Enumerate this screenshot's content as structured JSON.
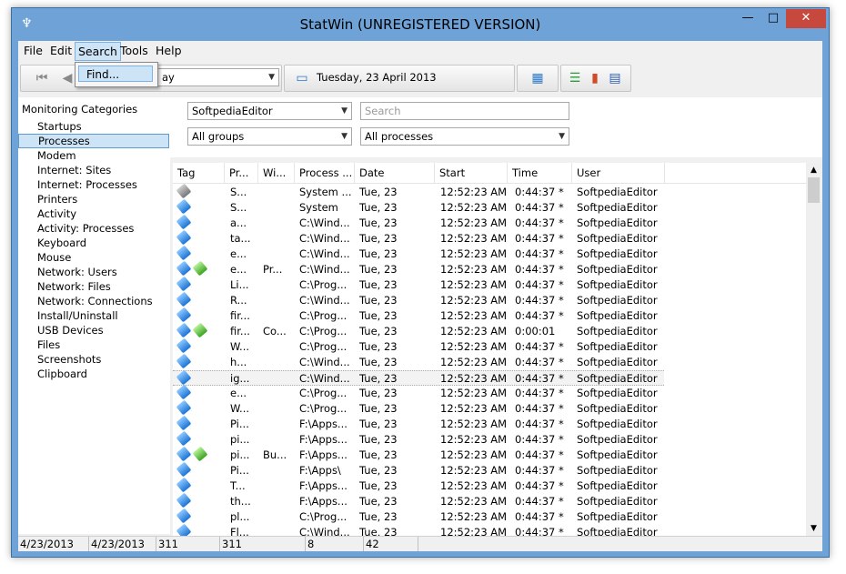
{
  "window": {
    "title": "StatWin (UNREGISTERED VERSION)",
    "minimize": "—",
    "maximize": "□",
    "close": "✕"
  },
  "menu": {
    "file": "File",
    "edit": "Edit",
    "search": "Search",
    "tools": "Tools",
    "help": "Help",
    "find_item": "Find..."
  },
  "toolbar": {
    "period_value": "ay",
    "date_text": "Tuesday, 23 April 2013"
  },
  "sidebar": {
    "header": "Monitoring Categories",
    "items": [
      "Startups",
      "Processes",
      "Modem",
      "Internet: Sites",
      "Internet: Processes",
      "Printers",
      "Activity",
      "Activity: Processes",
      "Keyboard",
      "Mouse",
      "Network: Users",
      "Network: Files",
      "Network: Connections",
      "Install/Uninstall",
      "USB Devices",
      "Files",
      "Screenshots",
      "Clipboard"
    ],
    "selected": "Processes"
  },
  "filters": {
    "user": "SoftpediaEditor",
    "search_placeholder": "Search",
    "groups": "All groups",
    "processes": "All processes"
  },
  "table": {
    "columns": [
      "Tag",
      "Pr...",
      "Wi...",
      "Process ...",
      "Date",
      "Start",
      "Time",
      "User"
    ],
    "rows": [
      {
        "tags": [
          "gray"
        ],
        "pr": "S...",
        "wi": "",
        "proc": "System ...",
        "date": "Tue, 23",
        "start": "12:52:23 AM",
        "time": "0:44:37 *",
        "user": "SoftpediaEditor"
      },
      {
        "tags": [
          "blue"
        ],
        "pr": "S...",
        "wi": "",
        "proc": "System",
        "date": "Tue, 23",
        "start": "12:52:23 AM",
        "time": "0:44:37 *",
        "user": "SoftpediaEditor"
      },
      {
        "tags": [
          "blue"
        ],
        "pr": "a...",
        "wi": "",
        "proc": "C:\\Wind...",
        "date": "Tue, 23",
        "start": "12:52:23 AM",
        "time": "0:44:37 *",
        "user": "SoftpediaEditor"
      },
      {
        "tags": [
          "blue"
        ],
        "pr": "ta...",
        "wi": "",
        "proc": "C:\\Wind...",
        "date": "Tue, 23",
        "start": "12:52:23 AM",
        "time": "0:44:37 *",
        "user": "SoftpediaEditor"
      },
      {
        "tags": [
          "blue"
        ],
        "pr": "e...",
        "wi": "",
        "proc": "C:\\Wind...",
        "date": "Tue, 23",
        "start": "12:52:23 AM",
        "time": "0:44:37 *",
        "user": "SoftpediaEditor"
      },
      {
        "tags": [
          "blue",
          "green"
        ],
        "pr": "e...",
        "wi": "Pr...",
        "proc": "C:\\Wind...",
        "date": "Tue, 23",
        "start": "12:52:23 AM",
        "time": "0:44:37 *",
        "user": "SoftpediaEditor"
      },
      {
        "tags": [
          "blue"
        ],
        "pr": "Li...",
        "wi": "",
        "proc": "C:\\Prog...",
        "date": "Tue, 23",
        "start": "12:52:23 AM",
        "time": "0:44:37 *",
        "user": "SoftpediaEditor"
      },
      {
        "tags": [
          "blue"
        ],
        "pr": "R...",
        "wi": "",
        "proc": "C:\\Wind...",
        "date": "Tue, 23",
        "start": "12:52:23 AM",
        "time": "0:44:37 *",
        "user": "SoftpediaEditor"
      },
      {
        "tags": [
          "blue"
        ],
        "pr": "fir...",
        "wi": "",
        "proc": "C:\\Prog...",
        "date": "Tue, 23",
        "start": "12:52:23 AM",
        "time": "0:44:37 *",
        "user": "SoftpediaEditor"
      },
      {
        "tags": [
          "blue",
          "green"
        ],
        "pr": "fir...",
        "wi": "Co...",
        "proc": "C:\\Prog...",
        "date": "Tue, 23",
        "start": "12:52:23 AM",
        "time": "0:00:01",
        "user": "SoftpediaEditor"
      },
      {
        "tags": [
          "blue"
        ],
        "pr": "W...",
        "wi": "",
        "proc": "C:\\Prog...",
        "date": "Tue, 23",
        "start": "12:52:23 AM",
        "time": "0:44:37 *",
        "user": "SoftpediaEditor"
      },
      {
        "tags": [
          "blue"
        ],
        "pr": "h...",
        "wi": "",
        "proc": "C:\\Wind...",
        "date": "Tue, 23",
        "start": "12:52:23 AM",
        "time": "0:44:37 *",
        "user": "SoftpediaEditor"
      },
      {
        "tags": [
          "blue"
        ],
        "pr": "ig...",
        "wi": "",
        "proc": "C:\\Wind...",
        "date": "Tue, 23",
        "start": "12:52:23 AM",
        "time": "0:44:37 *",
        "user": "SoftpediaEditor",
        "highlight": true
      },
      {
        "tags": [
          "blue"
        ],
        "pr": "e...",
        "wi": "",
        "proc": "C:\\Prog...",
        "date": "Tue, 23",
        "start": "12:52:23 AM",
        "time": "0:44:37 *",
        "user": "SoftpediaEditor"
      },
      {
        "tags": [
          "blue"
        ],
        "pr": "W...",
        "wi": "",
        "proc": "C:\\Prog...",
        "date": "Tue, 23",
        "start": "12:52:23 AM",
        "time": "0:44:37 *",
        "user": "SoftpediaEditor"
      },
      {
        "tags": [
          "blue"
        ],
        "pr": "Pi...",
        "wi": "",
        "proc": "F:\\Apps...",
        "date": "Tue, 23",
        "start": "12:52:23 AM",
        "time": "0:44:37 *",
        "user": "SoftpediaEditor"
      },
      {
        "tags": [
          "blue"
        ],
        "pr": "pi...",
        "wi": "",
        "proc": "F:\\Apps...",
        "date": "Tue, 23",
        "start": "12:52:23 AM",
        "time": "0:44:37 *",
        "user": "SoftpediaEditor"
      },
      {
        "tags": [
          "blue",
          "green"
        ],
        "pr": "pi...",
        "wi": "Bu...",
        "proc": "F:\\Apps...",
        "date": "Tue, 23",
        "start": "12:52:23 AM",
        "time": "0:44:37 *",
        "user": "SoftpediaEditor"
      },
      {
        "tags": [
          "blue"
        ],
        "pr": "Pi...",
        "wi": "",
        "proc": "F:\\Apps\\",
        "date": "Tue, 23",
        "start": "12:52:23 AM",
        "time": "0:44:37 *",
        "user": "SoftpediaEditor"
      },
      {
        "tags": [
          "blue"
        ],
        "pr": "T...",
        "wi": "",
        "proc": "F:\\Apps...",
        "date": "Tue, 23",
        "start": "12:52:23 AM",
        "time": "0:44:37 *",
        "user": "SoftpediaEditor"
      },
      {
        "tags": [
          "blue"
        ],
        "pr": "th...",
        "wi": "",
        "proc": "F:\\Apps...",
        "date": "Tue, 23",
        "start": "12:52:23 AM",
        "time": "0:44:37 *",
        "user": "SoftpediaEditor"
      },
      {
        "tags": [
          "blue"
        ],
        "pr": "pl...",
        "wi": "",
        "proc": "C:\\Prog...",
        "date": "Tue, 23",
        "start": "12:52:23 AM",
        "time": "0:44:37 *",
        "user": "SoftpediaEditor"
      },
      {
        "tags": [
          "blue"
        ],
        "pr": "Fl...",
        "wi": "",
        "proc": "C:\\Wind...",
        "date": "Tue, 23",
        "start": "12:52:23 AM",
        "time": "0:44:37 *",
        "user": "SoftpediaEditor"
      }
    ]
  },
  "status": {
    "date_from": "4/23/2013",
    "date_to": "4/23/2013",
    "count1": "311",
    "count2": "311",
    "count3": "8",
    "count4": "42"
  }
}
